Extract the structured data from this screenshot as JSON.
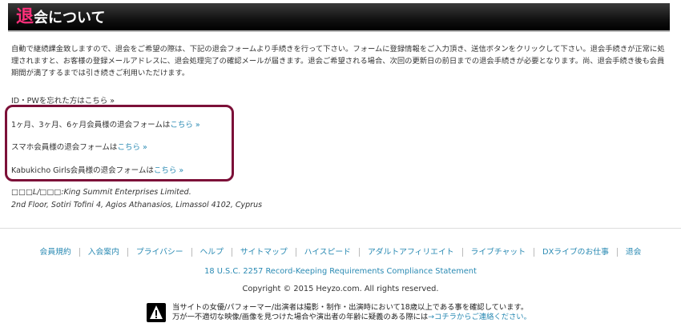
{
  "header": {
    "title_accent": "退",
    "title_rest": "会について"
  },
  "intro": {
    "paragraph": "自動で継続課金致しますので、退会をご希望の際は、下記の退会フォームより手続きを行って下さい。フォームに登録情報をご入力頂き、送信ボタンをクリックして下さい。退会手続きが正常に処理されますと、お客様の登録メールアドレスに、退会処理完了の確認メールが届きます。退会ご希望される場合、次回の更新日の前日までの退会手続きが必要となります。尚、退会手続き後も会員期間が満了するまでは引き続きご利用いただけます。"
  },
  "forgot_link": "ID・PWを忘れた方はこちら »",
  "forms": [
    {
      "label": "1ヶ月、3ヶ月、6ヶ月会員様の退会フォームは",
      "link": "こちら »"
    },
    {
      "label": "スマホ会員様の退会フォームは",
      "link": "こちら »"
    },
    {
      "label": "Kabukicho Girls会員様の退会フォームは",
      "link": "こちら »"
    }
  ],
  "company": {
    "line1": "□□□L/□□□:King Summit Enterprises Limited.",
    "line2": "2nd Floor, Sotiri Tofini 4, Agios Athanasios, Limassol 4102, Cyprus"
  },
  "footer": {
    "nav": [
      "会員規約",
      "入会案内",
      "プライバシー",
      "ヘルプ",
      "サイトマップ",
      "ハイスピード",
      "アダルトアフィリエイト",
      "ライブチャット",
      "DXライブのお仕事",
      "退会"
    ],
    "usc": "18 U.S.C. 2257 Record-Keeping Requirements Compliance Statement",
    "copyright": "Copyright © 2015 Heyzo.com. All rights reserved.",
    "notice_line1": "当サイトの女優/パフォーマー/出演者は撮影・制作・出演時において18歳以上である事を確認しています。",
    "notice_line2_text": "万が一不適切な映像/画像を見つけた場合や演出者の年齢に疑義のある際には",
    "notice_line2_link": "→コチラからご連絡ください。"
  },
  "colors": {
    "accent_pink": "#ff2f7a",
    "link_blue": "#2a8ab3",
    "highlight_border": "#7c1038"
  }
}
